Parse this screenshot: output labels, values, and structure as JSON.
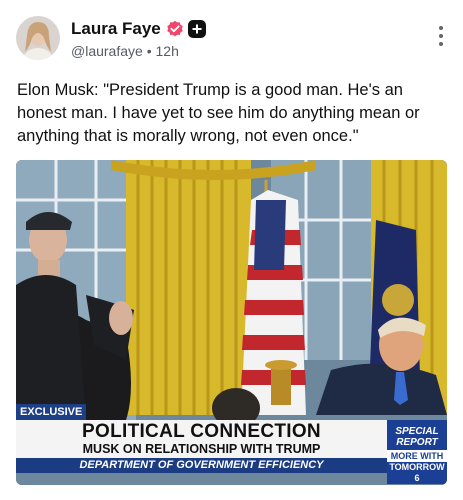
{
  "post": {
    "author_name": "Laura Faye",
    "handle": "@laurafaye",
    "separator": "•",
    "time_ago": "12h",
    "text": "Elon Musk: \"President Trump is a good man. He's an honest man. I have yet to see him do anything mean or anything that is morally wrong, not even once.\""
  },
  "icons": {
    "verified": "verified-badge-icon",
    "plus": "plus-badge-icon",
    "more": "more-options-icon"
  },
  "media": {
    "tag": "EXCLUSIVE",
    "headline": "POLITICAL CONNECTION",
    "subheadline": "MUSK ON RELATIONSHIP WITH TRUMP",
    "ticker": "DEPARTMENT OF GOVERNMENT EFFICIENCY",
    "special_line1": "SPECIAL",
    "special_line2": "REPORT",
    "more_with": "MORE WITH",
    "tomorrow": "TOMORROW 6"
  },
  "colors": {
    "verified_badge": "#f0466b",
    "chyron_blue": "#1b3b82",
    "curtain_gold": "#d9b92c"
  }
}
